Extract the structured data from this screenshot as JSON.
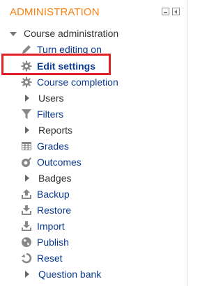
{
  "block": {
    "title": "ADMINISTRATION",
    "root_label": "Course administration",
    "items": [
      {
        "label": "Turn editing on",
        "icon": "pencil-icon",
        "type": "link"
      },
      {
        "label": "Edit settings",
        "icon": "gear-icon",
        "type": "link",
        "highlighted": true
      },
      {
        "label": "Course completion",
        "icon": "gear-icon",
        "type": "link"
      },
      {
        "label": "Users",
        "icon": "expand-arrow",
        "type": "folder"
      },
      {
        "label": "Filters",
        "icon": "filter-icon",
        "type": "link"
      },
      {
        "label": "Reports",
        "icon": "expand-arrow",
        "type": "folder"
      },
      {
        "label": "Grades",
        "icon": "grades-table-icon",
        "type": "link"
      },
      {
        "label": "Outcomes",
        "icon": "outcomes-icon",
        "type": "link"
      },
      {
        "label": "Badges",
        "icon": "expand-arrow",
        "type": "folder"
      },
      {
        "label": "Backup",
        "icon": "upload-icon",
        "type": "link"
      },
      {
        "label": "Restore",
        "icon": "download-icon",
        "type": "link"
      },
      {
        "label": "Import",
        "icon": "import-icon",
        "type": "link"
      },
      {
        "label": "Publish",
        "icon": "globe-icon",
        "type": "link"
      },
      {
        "label": "Reset",
        "icon": "reset-icon",
        "type": "link"
      },
      {
        "label": "Question bank",
        "icon": "expand-arrow",
        "type": "folder"
      }
    ]
  },
  "colors": {
    "accent": "#f98012",
    "link": "#0a3a8f",
    "highlight_border": "#e21f26"
  }
}
